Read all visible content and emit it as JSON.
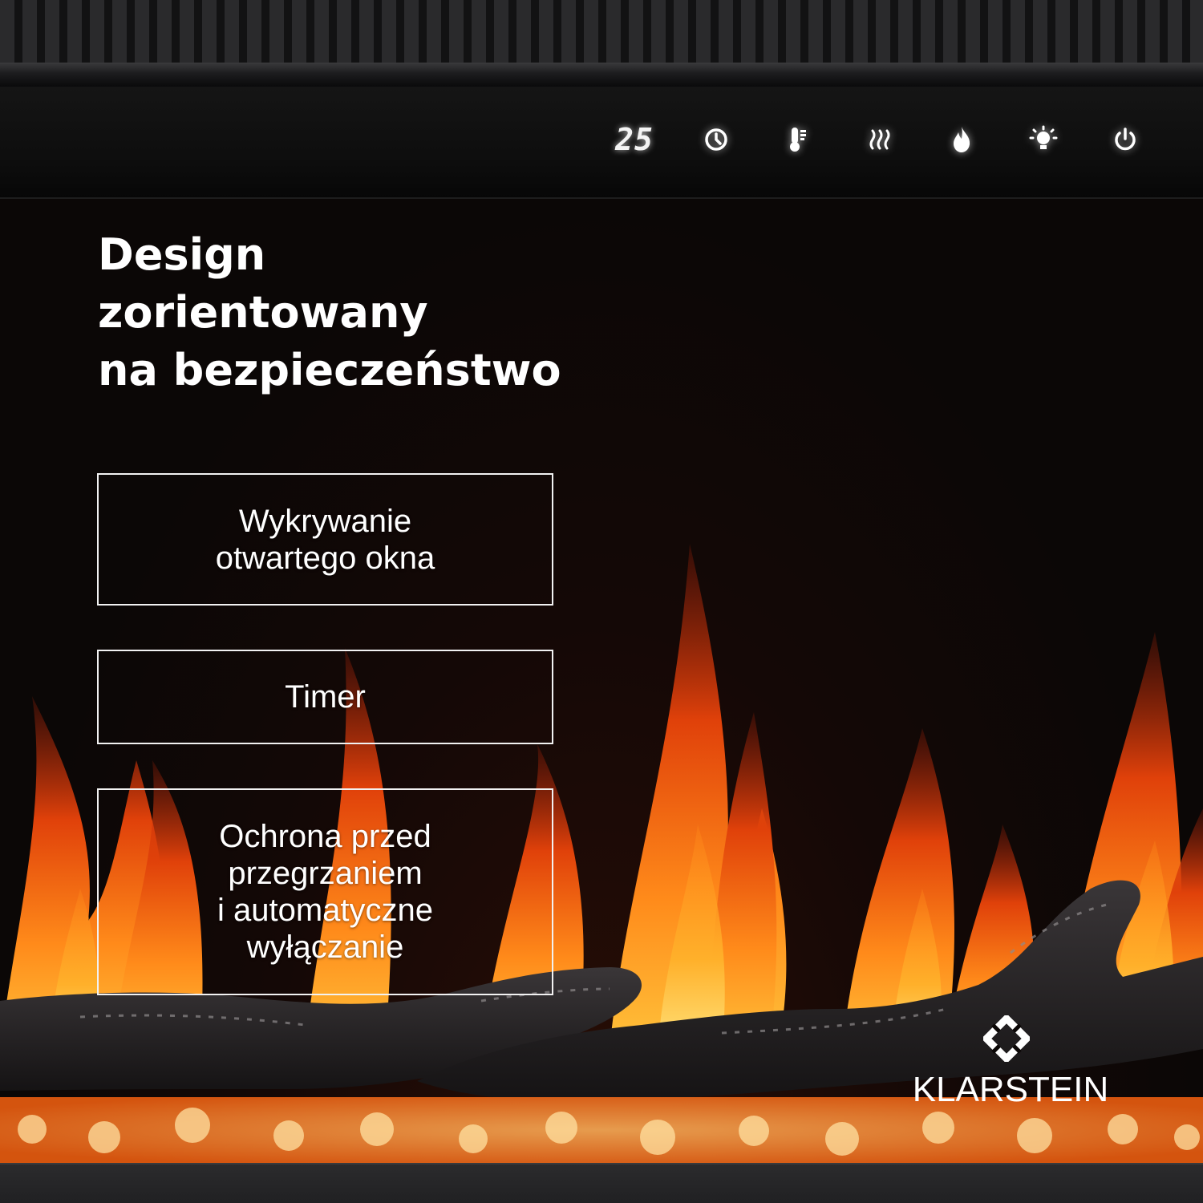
{
  "control_panel": {
    "display_value": "25",
    "icons": [
      "clock-icon",
      "thermometer-icon",
      "heat-waves-icon",
      "flame-icon",
      "light-bulb-icon",
      "power-icon"
    ]
  },
  "headline": {
    "lines": [
      "Design",
      "zorientowany",
      "na bezpieczeństwo"
    ]
  },
  "features": [
    {
      "lines": [
        "Wykrywanie",
        "otwartego okna"
      ]
    },
    {
      "lines": [
        "Timer"
      ]
    },
    {
      "lines": [
        "Ochrona przed",
        "przegrzaniem",
        "i automatyczne",
        "wyłączanie"
      ]
    }
  ],
  "brand": {
    "name": "KLARSTEIN"
  },
  "colors": {
    "frame": "#2a2a2c",
    "panel": "#111111",
    "flame_outer": "#e0410a",
    "flame_mid": "#ff8a1a",
    "flame_core": "#ffd24a",
    "text": "#ffffff"
  }
}
